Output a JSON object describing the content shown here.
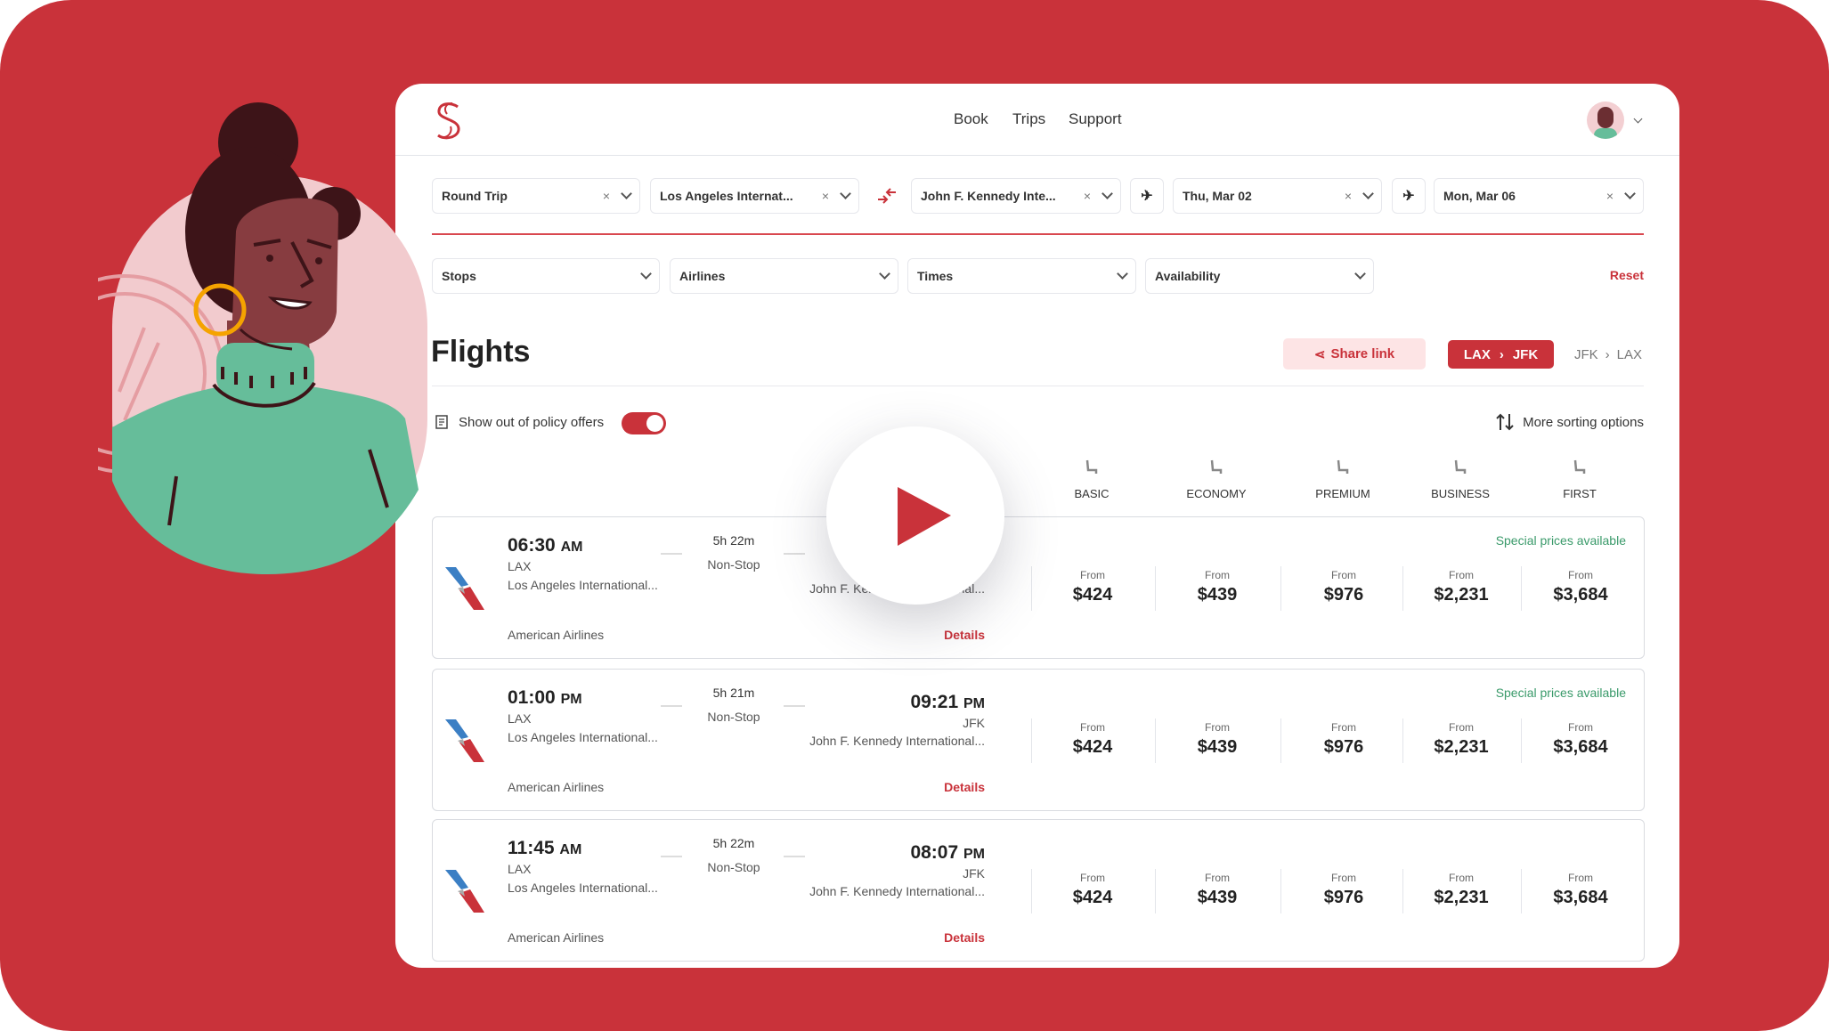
{
  "colors": {
    "brand": "#c9323a",
    "special": "#3a9a6a",
    "toggle_on": "#c9323a"
  },
  "header": {
    "logo": "S",
    "nav": [
      "Book",
      "Trips",
      "Support"
    ]
  },
  "search": {
    "trip_type": "Round Trip",
    "origin": "Los Angeles Internat...",
    "destination": "John F. Kennedy Inte...",
    "depart_date": "Thu, Mar 02",
    "return_date": "Mon, Mar 06",
    "clear": "×"
  },
  "filters": {
    "items": [
      "Stops",
      "Airlines",
      "Times",
      "Availability"
    ],
    "reset": "Reset"
  },
  "flights": {
    "title": "Flights",
    "share": "Share link",
    "route_active": {
      "from": "LAX",
      "sep": "›",
      "to": "JFK"
    },
    "route_inactive": {
      "from": "JFK",
      "sep": "›",
      "to": "LAX"
    },
    "policy_label": "Show out of policy offers",
    "policy_toggle_on": true,
    "sorting": "More sorting options",
    "cabins": [
      "BASIC",
      "ECONOMY",
      "PREMIUM",
      "BUSINESS",
      "FIRST"
    ],
    "results": [
      {
        "dep_time": "06:30",
        "dep_ampm": "AM",
        "dep_code": "LAX",
        "dep_airport": "Los Angeles International...",
        "duration": "5h 22m",
        "stops": "Non-Stop",
        "arr_time": "",
        "arr_ampm": "",
        "arr_code": "",
        "arr_airport": "John F. Kennedy International...",
        "airline": "American Airlines",
        "details": "Details",
        "special": "Special prices available",
        "from": "From",
        "prices": [
          "$424",
          "$439",
          "$976",
          "$2,231",
          "$3,684"
        ]
      },
      {
        "dep_time": "01:00",
        "dep_ampm": "PM",
        "dep_code": "LAX",
        "dep_airport": "Los Angeles International...",
        "duration": "5h 21m",
        "stops": "Non-Stop",
        "arr_time": "09:21",
        "arr_ampm": "PM",
        "arr_code": "JFK",
        "arr_airport": "John F. Kennedy International...",
        "airline": "American Airlines",
        "details": "Details",
        "special": "Special prices available",
        "from": "From",
        "prices": [
          "$424",
          "$439",
          "$976",
          "$2,231",
          "$3,684"
        ]
      },
      {
        "dep_time": "11:45",
        "dep_ampm": "AM",
        "dep_code": "LAX",
        "dep_airport": "Los Angeles International...",
        "duration": "5h 22m",
        "stops": "Non-Stop",
        "arr_time": "08:07",
        "arr_ampm": "PM",
        "arr_code": "JFK",
        "arr_airport": "John F. Kennedy International...",
        "airline": "American Airlines",
        "details": "Details",
        "special": "",
        "from": "From",
        "prices": [
          "$424",
          "$439",
          "$976",
          "$2,231",
          "$3,684"
        ]
      }
    ]
  },
  "video": {
    "icon": "play-icon"
  }
}
